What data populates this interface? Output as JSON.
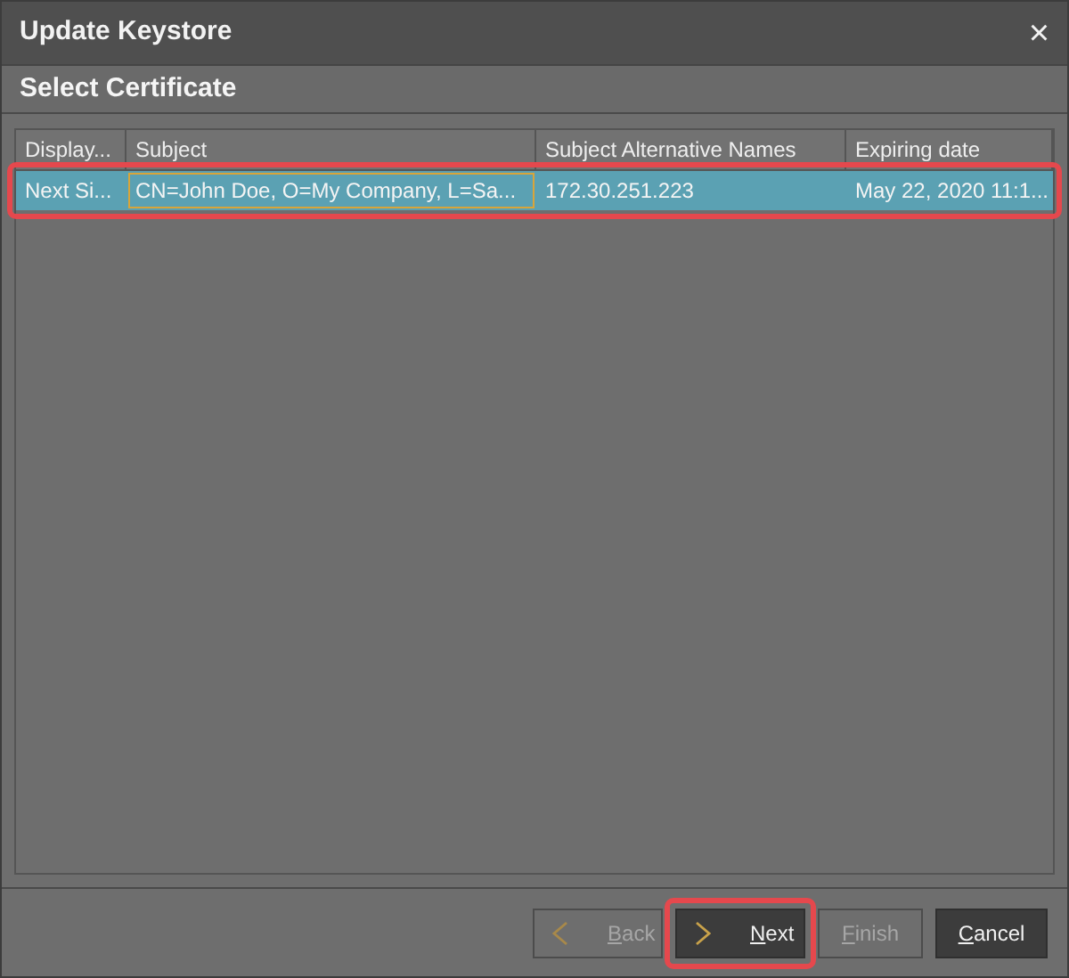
{
  "window": {
    "title": "Update Keystore",
    "close_glyph": "×"
  },
  "header": {
    "title": "Select Certificate"
  },
  "table": {
    "columns": [
      "Display...",
      "Subject",
      "Subject Alternative Names",
      "Expiring date"
    ],
    "rows": [
      {
        "cells": [
          "Next Si...",
          "CN=John Doe, O=My Company, L=Sa...",
          "172.30.251.223",
          "May 22, 2020 11:1..."
        ],
        "selected": true,
        "highlighted": true
      }
    ]
  },
  "buttons": [
    {
      "label": "Back",
      "kind": "back",
      "disabled": true,
      "highlighted": false
    },
    {
      "label": "Next",
      "kind": "next",
      "disabled": false,
      "highlighted": true
    },
    {
      "label": "Finish",
      "kind": "plain",
      "disabled": true,
      "highlighted": false
    },
    {
      "label": "Cancel",
      "kind": "plain",
      "disabled": false,
      "highlighted": false
    }
  ]
}
